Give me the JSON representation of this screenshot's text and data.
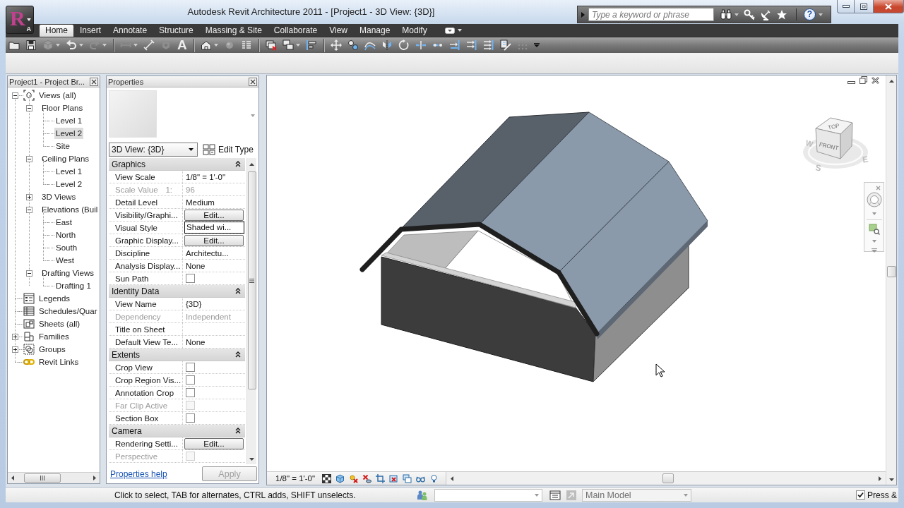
{
  "window": {
    "title": "Autodesk Revit Architecture 2011 - [Project1 - 3D View: {3D}]"
  },
  "app_menu": {
    "logo": "R",
    "badge": "A"
  },
  "search": {
    "placeholder": "Type a keyword or phrase",
    "help": "?"
  },
  "ribbon": {
    "tabs": [
      {
        "label": "Home",
        "selected": true
      },
      {
        "label": "Insert",
        "selected": false
      },
      {
        "label": "Annotate",
        "selected": false
      },
      {
        "label": "Structure",
        "selected": false
      },
      {
        "label": "Massing & Site",
        "selected": false
      },
      {
        "label": "Collaborate",
        "selected": false
      },
      {
        "label": "View",
        "selected": false
      },
      {
        "label": "Manage",
        "selected": false
      },
      {
        "label": "Modify",
        "selected": false
      }
    ]
  },
  "quick_access": {
    "text_tool": "A"
  },
  "project_browser": {
    "title": "Project1 - Project Br...",
    "tree": [
      {
        "label": "Views (all)",
        "kind": "views",
        "expanded": true,
        "selected": false,
        "children": [
          {
            "label": "Floor Plans",
            "expanded": true,
            "selected": false,
            "children": [
              {
                "label": "Level 1",
                "selected": false
              },
              {
                "label": "Level 2",
                "selected": true
              },
              {
                "label": "Site",
                "selected": false
              }
            ]
          },
          {
            "label": "Ceiling Plans",
            "expanded": true,
            "selected": false,
            "children": [
              {
                "label": "Level 1",
                "selected": false
              },
              {
                "label": "Level 2",
                "selected": false
              }
            ]
          },
          {
            "label": "3D Views",
            "expanded": false,
            "selected": false
          },
          {
            "label": "Elevations (Buil",
            "expanded": true,
            "selected": false,
            "children": [
              {
                "label": "East",
                "selected": false
              },
              {
                "label": "North",
                "selected": false
              },
              {
                "label": "South",
                "selected": false
              },
              {
                "label": "West",
                "selected": false
              }
            ]
          },
          {
            "label": "Drafting Views",
            "expanded": true,
            "selected": false,
            "children": [
              {
                "label": "Drafting 1",
                "selected": false
              }
            ]
          }
        ]
      },
      {
        "label": "Legends",
        "kind": "legends",
        "selected": false
      },
      {
        "label": "Schedules/Quar",
        "kind": "schedules",
        "selected": false
      },
      {
        "label": "Sheets (all)",
        "kind": "sheets",
        "selected": false
      },
      {
        "label": "Families",
        "kind": "families",
        "expanded": false,
        "selected": false
      },
      {
        "label": "Groups",
        "kind": "groups",
        "expanded": false,
        "selected": false
      },
      {
        "label": "Revit Links",
        "kind": "links",
        "selected": false
      }
    ]
  },
  "properties": {
    "title": "Properties",
    "type": "3D View: {3D}",
    "edit_type": "Edit Type",
    "groups": [
      {
        "label": "Graphics",
        "expanded": true,
        "rows": [
          {
            "label": "View Scale",
            "kind": "text",
            "value": "1/8\" = 1'-0\"",
            "disabled": false
          },
          {
            "label": "Scale Value",
            "unit": "1:",
            "kind": "text",
            "value": "96",
            "disabled": true
          },
          {
            "label": "Detail Level",
            "kind": "text",
            "value": "Medium",
            "disabled": false
          },
          {
            "label": "Visibility/Graphi...",
            "kind": "button",
            "value": "Edit...",
            "disabled": false
          },
          {
            "label": "Visual Style",
            "kind": "field",
            "value": "Shaded wi...",
            "disabled": false
          },
          {
            "label": "Graphic Display...",
            "kind": "button",
            "value": "Edit...",
            "disabled": false
          },
          {
            "label": "Discipline",
            "kind": "text",
            "value": "Architectu...",
            "disabled": false
          },
          {
            "label": "Analysis Display...",
            "kind": "text",
            "value": "None",
            "disabled": false
          },
          {
            "label": "Sun Path",
            "kind": "checkbox",
            "checked": false,
            "disabled": false
          }
        ]
      },
      {
        "label": "Identity Data",
        "expanded": true,
        "rows": [
          {
            "label": "View Name",
            "kind": "text",
            "value": "{3D}",
            "disabled": false
          },
          {
            "label": "Dependency",
            "kind": "text",
            "value": "Independent",
            "disabled": true
          },
          {
            "label": "Title on Sheet",
            "kind": "text",
            "disabled": false
          },
          {
            "label": "Default View Te...",
            "kind": "text",
            "value": "None",
            "disabled": false
          }
        ]
      },
      {
        "label": "Extents",
        "expanded": true,
        "rows": [
          {
            "label": "Crop View",
            "kind": "checkbox",
            "checked": false,
            "disabled": false
          },
          {
            "label": "Crop Region Vis...",
            "kind": "checkbox",
            "checked": false,
            "disabled": false
          },
          {
            "label": "Annotation Crop",
            "kind": "checkbox",
            "checked": false,
            "disabled": false
          },
          {
            "label": "Far Clip Active",
            "kind": "checkbox",
            "checked": false,
            "disabled": true
          },
          {
            "label": "Section Box",
            "kind": "checkbox",
            "checked": false,
            "disabled": false
          }
        ]
      },
      {
        "label": "Camera",
        "expanded": true,
        "rows": [
          {
            "label": "Rendering Setti...",
            "kind": "button",
            "value": "Edit...",
            "disabled": false
          },
          {
            "label": "Perspective",
            "kind": "checkbox",
            "checked": false,
            "disabled": true
          }
        ]
      }
    ],
    "help_link": "Properties help",
    "apply": {
      "label": "Apply",
      "disabled": true
    }
  },
  "view": {
    "scale": "1/8\" = 1'-0\"",
    "view_cube": {
      "faces": [
        {
          "kind": "top",
          "label": "TOP"
        },
        {
          "kind": "front",
          "label": "FRONT"
        }
      ],
      "compass": [
        {
          "kind": "west",
          "label": "W"
        },
        {
          "kind": "south",
          "label": "S"
        },
        {
          "kind": "east",
          "label": "E"
        }
      ]
    }
  },
  "status_bar": {
    "message": "Click to select, TAB for alternates, CTRL adds, SHIFT unselects.",
    "model": {
      "value": "Main Model",
      "disabled": true
    },
    "press_drag": {
      "label": "Press &",
      "checked": true
    }
  }
}
